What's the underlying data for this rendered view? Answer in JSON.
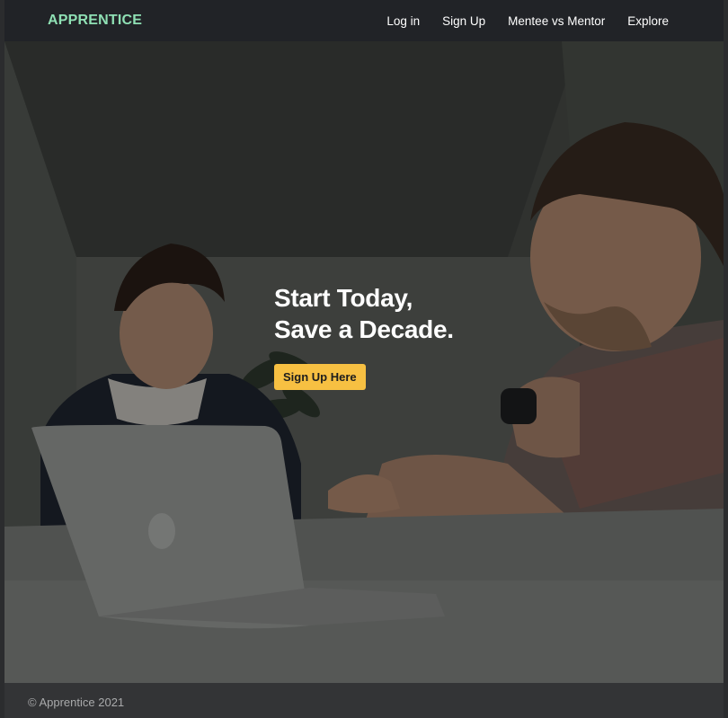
{
  "brand": "APPRENTICE",
  "nav": [
    {
      "label": "Log in"
    },
    {
      "label": "Sign Up"
    },
    {
      "label": "Mentee vs Mentor"
    },
    {
      "label": "Explore"
    }
  ],
  "hero": {
    "title_line1": "Start Today,",
    "title_line2": "Save a Decade.",
    "cta_label": "Sign Up Here"
  },
  "footer": {
    "copyright": "© Apprentice 2021"
  },
  "colors": {
    "brand": "#8fe0b4",
    "cta": "#f7c042",
    "navbar": "#212327",
    "footer": "#333436"
  }
}
